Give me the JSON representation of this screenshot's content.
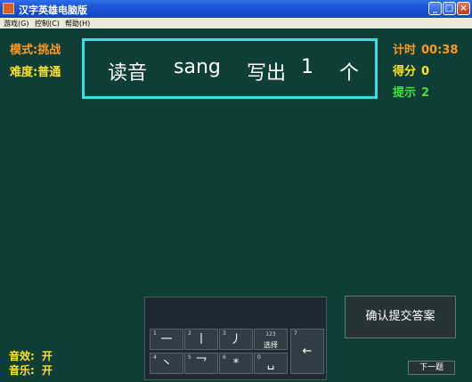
{
  "window": {
    "title": "汉字英雄电脑版",
    "buttons": {
      "minimize": "_",
      "maximize": "□",
      "close": "×"
    }
  },
  "menu": [
    {
      "label": "游戏(G)"
    },
    {
      "label": "控制(C)"
    },
    {
      "label": "帮助(H)"
    }
  ],
  "left_panel": {
    "mode_label": "模式:",
    "mode_value": "挑战",
    "difficulty_label": "难度:",
    "difficulty_value": "普通"
  },
  "right_panel": {
    "timer_label": "计时",
    "timer_value": "00:38",
    "score_label": "得分",
    "score_value": "0",
    "hint_label": "提示",
    "hint_value": "2"
  },
  "prompt": {
    "read_label": "读音",
    "pinyin": "sang",
    "write_label": "写出",
    "count": "1",
    "unit": "个"
  },
  "keypad": {
    "keys": [
      {
        "num": "1",
        "glyph": "一"
      },
      {
        "num": "2",
        "glyph": "丨"
      },
      {
        "num": "3",
        "glyph": "丿"
      },
      {
        "num": "123",
        "glyph": "选择"
      },
      {
        "num": "7",
        "glyph": "←"
      },
      {
        "num": "4",
        "glyph": "丶"
      },
      {
        "num": "5",
        "glyph": "乛"
      },
      {
        "num": "6",
        "glyph": "*"
      },
      {
        "num": "0",
        "glyph": "␣"
      }
    ]
  },
  "buttons": {
    "submit": "确认提交答案",
    "next": "下一题"
  },
  "footer": {
    "sound_effects_label": "音效:",
    "sound_effects_value": "开",
    "music_label": "音乐:",
    "music_value": "开"
  },
  "colors": {
    "background": "#0f3e36",
    "accent_cyan": "#35e0e6",
    "orange": "#ff9a1e",
    "yellow": "#ffe21a",
    "green": "#3ee53e"
  },
  "icons": {
    "app": "app-icon",
    "backspace": "backspace-icon",
    "space": "space-icon"
  }
}
